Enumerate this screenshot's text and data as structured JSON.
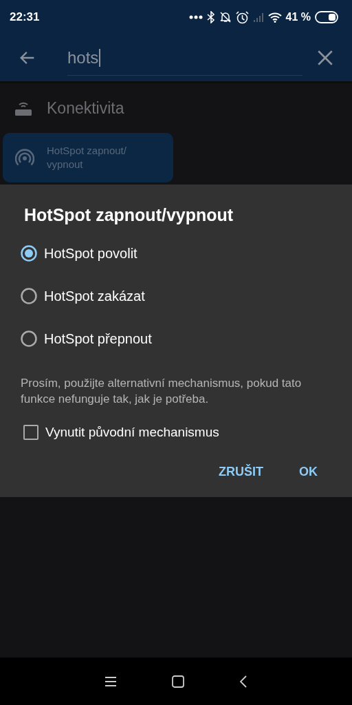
{
  "status_bar": {
    "time": "22:31",
    "battery_text": "41 %"
  },
  "search": {
    "value": "hots"
  },
  "category": {
    "label": "Konektivita"
  },
  "results": [
    {
      "label": "HotSpot zapnout/\nvypnout",
      "selected": true
    }
  ],
  "dialog": {
    "title": "HotSpot zapnout/vypnout",
    "options": [
      {
        "label": "HotSpot povolit",
        "selected": true
      },
      {
        "label": "HotSpot zakázat",
        "selected": false
      },
      {
        "label": "HotSpot přepnout",
        "selected": false
      }
    ],
    "note": "Prosím, použijte alternativní mechanismus, pokud tato funkce nefunguje tak, jak je potřeba.",
    "checkbox": {
      "label": "Vynutit původní mechanismus",
      "checked": false
    },
    "buttons": [
      "ZRUŠIT",
      "OK"
    ]
  }
}
